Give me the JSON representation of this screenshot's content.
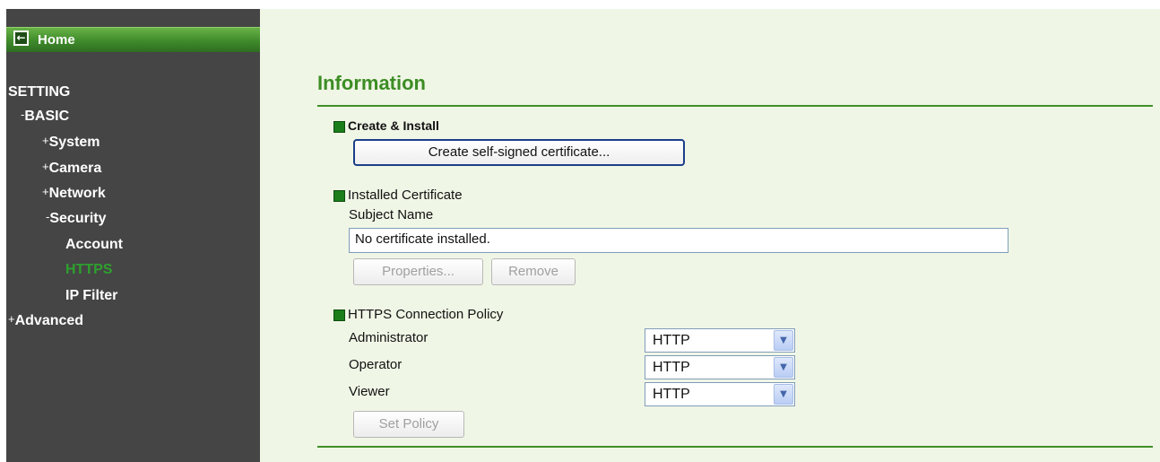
{
  "sidebar": {
    "home_label": "Home",
    "items": [
      {
        "prefix": "",
        "label": "SETTING"
      },
      {
        "prefix": "-",
        "label": "BASIC"
      },
      {
        "prefix": "+",
        "label": "System"
      },
      {
        "prefix": "+",
        "label": "Camera"
      },
      {
        "prefix": "+",
        "label": "Network"
      },
      {
        "prefix": "-",
        "label": "Security"
      },
      {
        "prefix": "",
        "label": "Account"
      },
      {
        "prefix": "",
        "label": "HTTPS"
      },
      {
        "prefix": "",
        "label": "IP Filter"
      },
      {
        "prefix": "+",
        "label": "Advanced"
      }
    ]
  },
  "main": {
    "title": "Information",
    "create_section": {
      "heading": "Create & Install",
      "button_label": "Create self-signed certificate..."
    },
    "installed_section": {
      "heading": "Installed Certificate",
      "subject_label": "Subject Name",
      "subject_value": "No certificate installed.",
      "properties_label": "Properties...",
      "remove_label": "Remove"
    },
    "policy_section": {
      "heading": "HTTPS Connection Policy",
      "rows": [
        {
          "label": "Administrator",
          "value": "HTTP"
        },
        {
          "label": "Operator",
          "value": "HTTP"
        },
        {
          "label": "Viewer",
          "value": "HTTP"
        }
      ],
      "set_policy_label": "Set Policy"
    }
  },
  "icons": {
    "home": "back-arrow-icon",
    "section_marker": "green-square-icon",
    "dropdown": "chevron-down-icon"
  },
  "colors": {
    "sidebar_bg": "#454545",
    "active_nav": "#2ea02e",
    "accent_green": "#3c8d24",
    "content_bg": "#f0f6e6"
  }
}
